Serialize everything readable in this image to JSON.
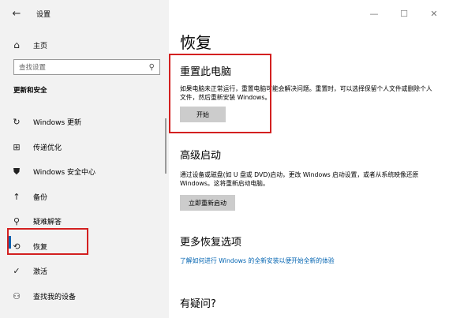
{
  "window": {
    "title": "设置",
    "back_glyph": "←",
    "minimize_glyph": "—",
    "maximize_glyph": "☐",
    "close_glyph": "✕"
  },
  "sidebar": {
    "home_label": "主页",
    "search_placeholder": "查找设置",
    "section_title": "更新和安全",
    "items": [
      {
        "label": "Windows 更新",
        "icon": "refresh-icon",
        "glyph": "↻"
      },
      {
        "label": "传递优化",
        "icon": "delivery-optimization-icon",
        "glyph": "⊞"
      },
      {
        "label": "Windows 安全中心",
        "icon": "shield-icon",
        "glyph": "⛊"
      },
      {
        "label": "备份",
        "icon": "backup-icon",
        "glyph": "↑"
      },
      {
        "label": "疑难解答",
        "icon": "wrench-icon",
        "glyph": "⚲"
      },
      {
        "label": "恢复",
        "icon": "recovery-icon",
        "glyph": "⟲"
      },
      {
        "label": "激活",
        "icon": "activation-icon",
        "glyph": "✓"
      },
      {
        "label": "查找我的设备",
        "icon": "find-device-icon",
        "glyph": "⚇"
      }
    ],
    "selected_item": "恢复"
  },
  "main": {
    "page_title": "恢复",
    "reset": {
      "title": "重置此电脑",
      "description": "如果电脑未正常运行，重置电脑可能会解决问题。重置时，可以选择保留个人文件或删除个人文件，然后重新安装 Windows。",
      "button": "开始"
    },
    "advanced": {
      "title": "高级启动",
      "description": "通过设备或磁盘(如 U 盘或 DVD)启动，更改 Windows 启动设置，或者从系统映像还原 Windows。这将重新启动电脑。",
      "button": "立即重新启动"
    },
    "more": {
      "title": "更多恢复选项",
      "link": "了解如何进行 Windows 的全新安装以便开始全新的体验"
    },
    "question_title": "有疑问?"
  },
  "colors": {
    "accent": "#0063b1",
    "highlight_red": "#d32020",
    "sidebar_bg": "#f2f2f2",
    "button_bg": "#cccccc"
  }
}
